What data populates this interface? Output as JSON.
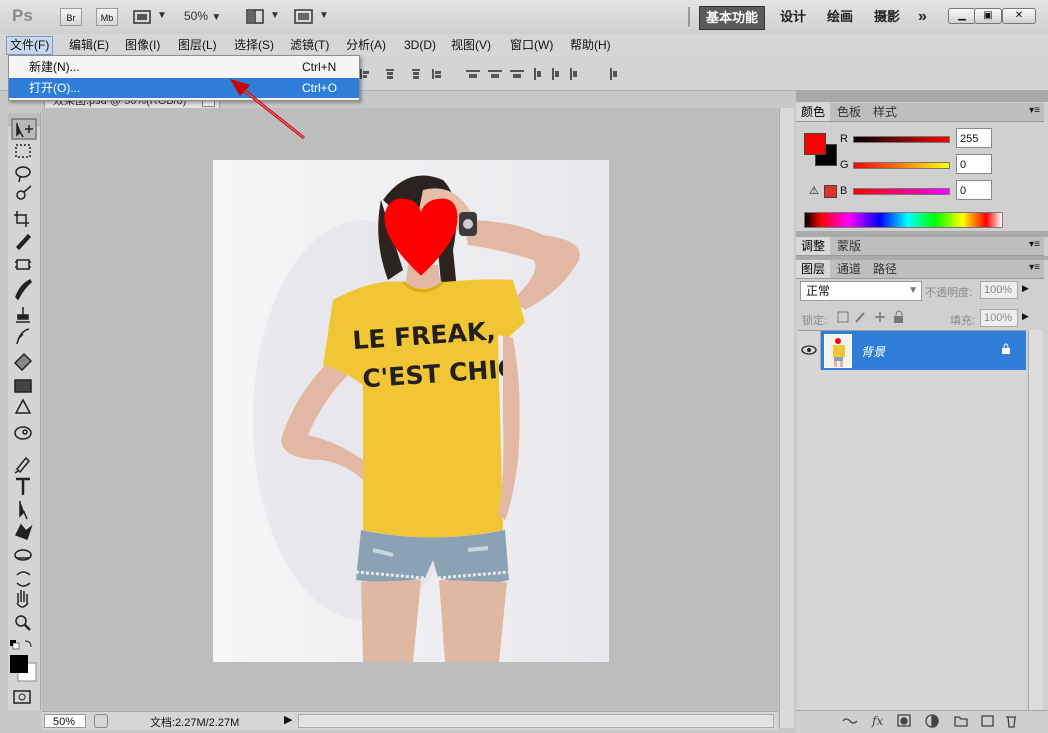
{
  "titlebar": {
    "logo": "Ps",
    "br_label": "Br",
    "mb_label": "Mb",
    "zoom_value": "50%",
    "workspaces": [
      "基本功能",
      "设计",
      "绘画",
      "摄影"
    ],
    "more_label": "»"
  },
  "menubar": {
    "items": [
      "文件(F)",
      "编辑(E)",
      "图像(I)",
      "图层(L)",
      "选择(S)",
      "滤镜(T)",
      "分析(A)",
      "3D(D)",
      "视图(V)",
      "窗口(W)",
      "帮助(H)"
    ]
  },
  "file_menu": {
    "items": [
      {
        "label": "新建(N)...",
        "shortcut": "Ctrl+N"
      },
      {
        "label": "打开(O)...",
        "shortcut": "Ctrl+O"
      }
    ]
  },
  "document": {
    "tab_title": "效果图.psd @ 50%(RGB/8)",
    "tab_close": "×",
    "shirt_text_line1": "LE FREAK,",
    "shirt_text_line2": "C'EST CHIC"
  },
  "status": {
    "zoom": "50%",
    "doc_size": "文档:2.27M/2.27M"
  },
  "color_panel": {
    "tabs": [
      "颜色",
      "色板",
      "样式"
    ],
    "r_label": "R",
    "g_label": "G",
    "b_label": "B",
    "r_value": "255",
    "g_value": "0",
    "b_value": "0",
    "foreground_color": "#ff0000",
    "background_color": "#000000"
  },
  "adjust_panel": {
    "tabs": [
      "调整",
      "蒙版"
    ]
  },
  "layers_panel": {
    "tabs": [
      "图层",
      "通道",
      "路径"
    ],
    "blend_mode": "正常",
    "opacity_label": "不透明度:",
    "opacity_value": "100%",
    "lock_label": "锁定:",
    "fill_label": "填充:",
    "fill_value": "100%",
    "layers": [
      {
        "name": "背景"
      }
    ]
  },
  "colors": {
    "highlight": "#2e7dd6",
    "accent_red": "#ff0000"
  }
}
